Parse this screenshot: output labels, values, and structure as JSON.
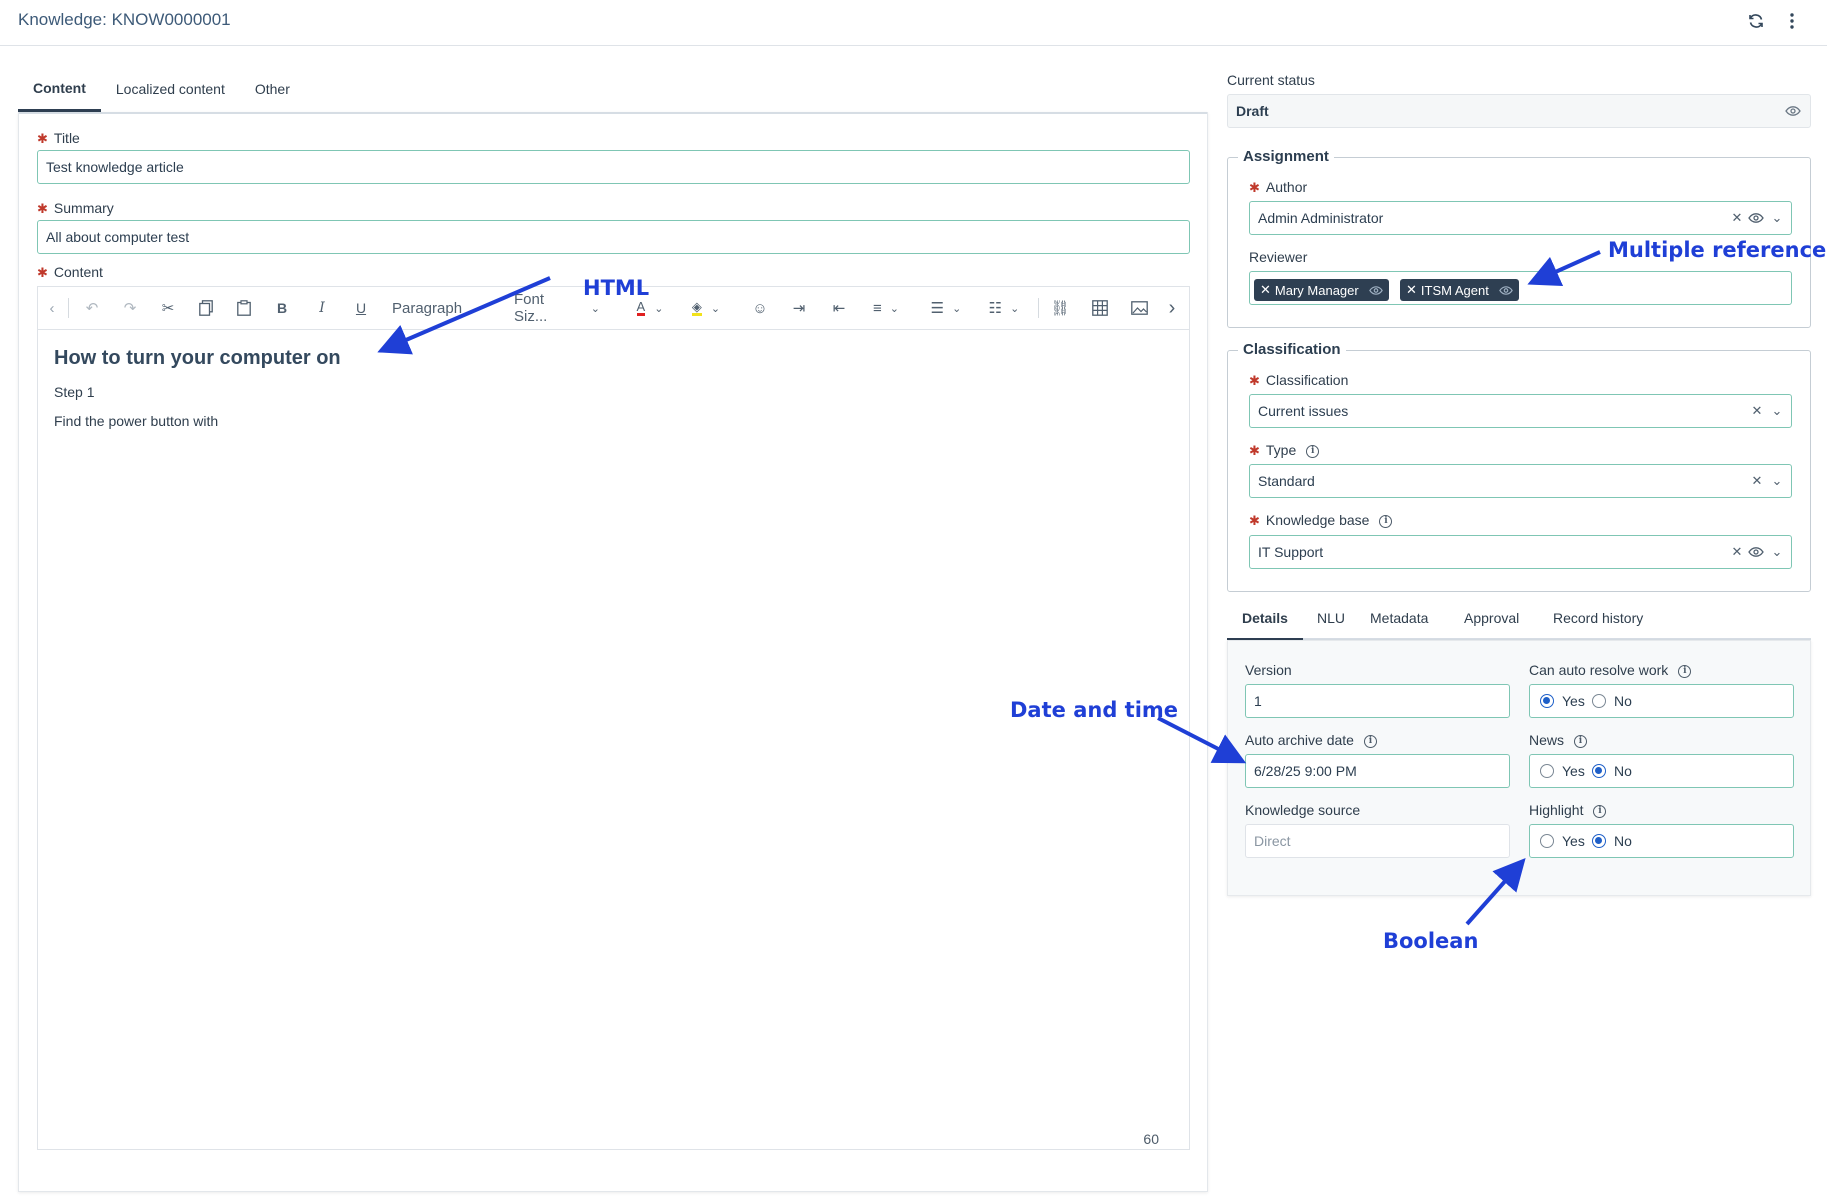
{
  "header": {
    "title": "Knowledge: KNOW0000001",
    "refresh_icon": "refresh-icon",
    "more_icon": "more-vertical-icon"
  },
  "tabs": [
    "Content",
    "Localized content",
    "Other"
  ],
  "form": {
    "title_label": "Title",
    "title_value": "Test knowledge article",
    "summary_label": "Summary",
    "summary_value": "All about computer test",
    "content_label": "Content"
  },
  "editor": {
    "paragraph_select": "Paragraph",
    "font_size_select": "Font Siz...",
    "heading": "How to turn your computer on",
    "lines": [
      "Step 1",
      "Find the power button with"
    ],
    "word_count": "60"
  },
  "status": {
    "label": "Current status",
    "value": "Draft"
  },
  "assignment": {
    "legend": "Assignment",
    "author_label": "Author",
    "author_value": "Admin Administrator",
    "reviewer_label": "Reviewer",
    "reviewers": [
      "Mary Manager",
      "ITSM Agent"
    ]
  },
  "classification": {
    "legend": "Classification",
    "classification_label": "Classification",
    "classification_value": "Current issues",
    "type_label": "Type",
    "type_value": "Standard",
    "kb_label": "Knowledge base",
    "kb_value": "IT Support"
  },
  "detail_tabs": [
    "Details",
    "NLU",
    "Metadata",
    "Approval",
    "Record history"
  ],
  "details": {
    "version_label": "Version",
    "version_value": "1",
    "auto_archive_label": "Auto archive date",
    "auto_archive_value": "6/28/25 9:00 PM",
    "knowledge_source_label": "Knowledge source",
    "knowledge_source_placeholder": "Direct",
    "can_auto_resolve_label": "Can auto resolve work",
    "news_label": "News",
    "highlight_label": "Highlight",
    "yes": "Yes",
    "no": "No",
    "can_auto_resolve_value": "Yes",
    "news_value": "No",
    "highlight_value": "No"
  },
  "annotations": {
    "html": "HTML",
    "multiple_reference": "Multiple reference",
    "date_and_time": "Date and time",
    "boolean": "Boolean"
  },
  "colors": {
    "annotation": "#1f3fd6",
    "chip": "#2e3f52",
    "input_border": "#7fc6b4",
    "required": "#c0392b"
  }
}
